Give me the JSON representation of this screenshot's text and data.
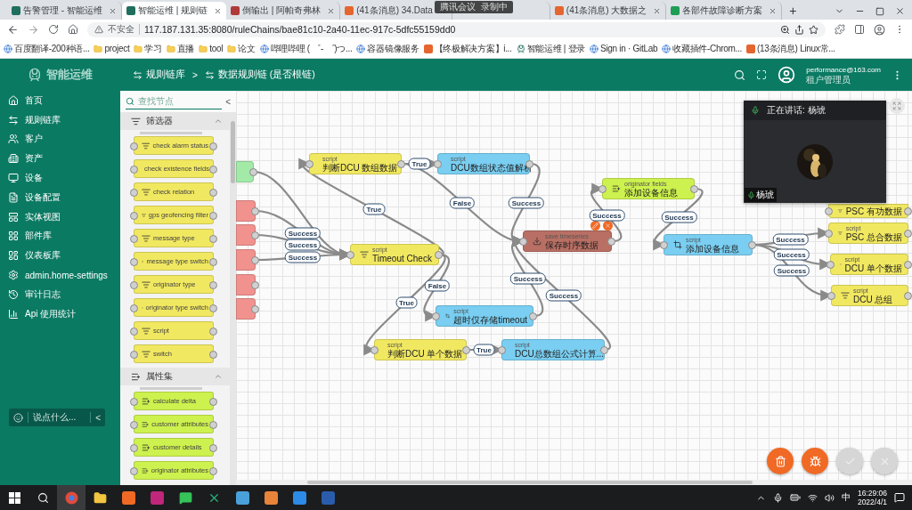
{
  "browser": {
    "tabs": [
      {
        "title": "告警管理 - 智能运维",
        "kind": "app",
        "selected": false
      },
      {
        "title": "智能运维 | 规则链",
        "kind": "app",
        "selected": true
      },
      {
        "title": "倒输出 | 阿帕奇弗林",
        "kind": "video",
        "selected": false
      },
      {
        "title": "(41条消息) 34.Data",
        "kind": "blog",
        "selected": false
      },
      {
        "selected": false
      },
      {
        "title": "(41条消息) 大数据之",
        "kind": "blog",
        "selected": false
      },
      {
        "title": "各部件故障诊断方案",
        "kind": "sheet",
        "selected": false
      }
    ],
    "new_tab": "+",
    "meeting_badge": {
      "app": "腾讯会议",
      "status": "录制中"
    },
    "address": {
      "security": "不安全",
      "url": "117.187.131.35:8080/ruleChains/bae81c10-2a40-11ec-917c-5dfc55159dd0"
    },
    "bookmarks": [
      {
        "label": "百度翻译-200种语...",
        "kind": "site"
      },
      {
        "label": "project",
        "kind": "folder"
      },
      {
        "label": "学习",
        "kind": "folder"
      },
      {
        "label": "直播",
        "kind": "folder"
      },
      {
        "label": "tool",
        "kind": "folder"
      },
      {
        "label": "论文",
        "kind": "folder"
      },
      {
        "label": "哔哩哔哩 ( ゜- ゜)つ...",
        "kind": "site"
      },
      {
        "label": "容器镜像服务",
        "kind": "site"
      },
      {
        "label": "【终极解决方案】i...",
        "kind": "blog"
      },
      {
        "label": "智能运维 | 登录",
        "kind": "app"
      },
      {
        "label": "Sign in · GitLab",
        "kind": "site"
      },
      {
        "label": "收藏插件-Chrom...",
        "kind": "site"
      },
      {
        "label": "(13条消息) Linux常...",
        "kind": "blog"
      }
    ]
  },
  "app": {
    "brand": "智能运维",
    "breadcrumb": {
      "items": [
        "规则链库",
        "数据规则链 (是否根链)"
      ],
      "separator": ">"
    },
    "user": {
      "email": "performance@163.com",
      "role": "租户管理员"
    },
    "nav": [
      {
        "label": "首页"
      },
      {
        "label": "规则链库"
      },
      {
        "label": "客户"
      },
      {
        "label": "资产"
      },
      {
        "label": "设备"
      },
      {
        "label": "设备配置"
      },
      {
        "label": "实体视图"
      },
      {
        "label": "部件库"
      },
      {
        "label": "仪表板库"
      },
      {
        "label": "admin.home-settings"
      },
      {
        "label": "审计日志"
      },
      {
        "label": "Api 使用统计"
      }
    ],
    "chat": {
      "placeholder": "说点什么...",
      "collapse": "<"
    }
  },
  "library": {
    "search": {
      "placeholder": "查找节点"
    },
    "collapse": "<",
    "sections": [
      {
        "title": "筛选器",
        "kind": "filter",
        "expanded": true,
        "nodes": [
          "check alarm status",
          "check existence fields",
          "check relation",
          "gps geofencing filter",
          "message type",
          "message type switch",
          "originator type",
          "originator type switch",
          "script",
          "switch"
        ]
      },
      {
        "title": "属性集",
        "kind": "enrichment",
        "expanded": true,
        "nodes": [
          "calculate delta",
          "customer attributes",
          "customer details",
          "originator attributes"
        ]
      }
    ]
  },
  "canvas": {
    "nodes": [
      {
        "kind": "input"
      },
      {
        "kind": "external"
      },
      {
        "kind": "external"
      },
      {
        "kind": "external"
      },
      {
        "kind": "external"
      },
      {
        "kind": "external"
      },
      {
        "kind": "filter",
        "title": "script",
        "subtitle": "判断DCU 数组数据"
      },
      {
        "kind": "transform",
        "title": "script",
        "subtitle": "DCU数组状态值解析"
      },
      {
        "kind": "filter",
        "title": "script",
        "subtitle": "Timeout Check"
      },
      {
        "kind": "action",
        "title": "save timeseries",
        "subtitle": "保存时序数据",
        "hovered": true
      },
      {
        "kind": "enrichment",
        "title": "originator fields",
        "subtitle": "添加设备信息"
      },
      {
        "kind": "transform",
        "title": "script",
        "subtitle": "添加设备信息"
      },
      {
        "kind": "filter",
        "subtitle": "PSC 有功数据"
      },
      {
        "kind": "filter",
        "title": "script",
        "subtitle": "PSC 总合数据"
      },
      {
        "kind": "filter",
        "title": "script",
        "subtitle": "DCU 单个数据"
      },
      {
        "kind": "filter",
        "title": "script",
        "subtitle": "DCU 总组"
      },
      {
        "kind": "transform",
        "title": "script",
        "subtitle": "超时仅存储timeout"
      },
      {
        "kind": "filter",
        "title": "script",
        "subtitle": "判断DCU 单个数据"
      },
      {
        "kind": "transform",
        "title": "script",
        "subtitle": "DCU总数组公式计算..."
      }
    ],
    "links": [
      "True",
      "True",
      "False",
      "Success",
      "Success",
      "Success",
      "Success",
      "False",
      "True",
      "True",
      "Success",
      "Success",
      "Success",
      "Success",
      "Success",
      "Success",
      "Success"
    ]
  },
  "video": {
    "speaking": "正在讲话: 杨琥",
    "name": "杨琥"
  },
  "actions": [
    {
      "kind": "delete",
      "disabled": false
    },
    {
      "kind": "debug",
      "disabled": false
    },
    {
      "kind": "apply",
      "disabled": true
    },
    {
      "kind": "cancel",
      "disabled": true
    }
  ],
  "taskbar": {
    "ime": "中",
    "time": "16:29:06",
    "date": "2022/4/1"
  }
}
